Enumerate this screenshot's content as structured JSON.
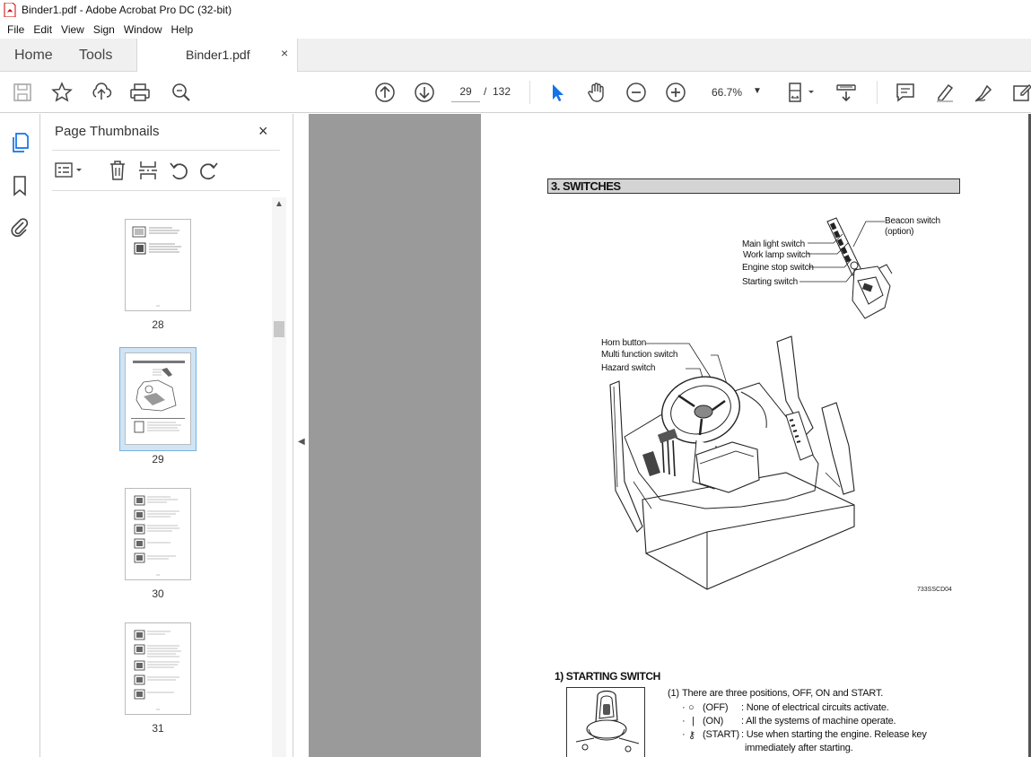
{
  "window": {
    "title": "Binder1.pdf - Adobe Acrobat Pro DC (32-bit)"
  },
  "menu": [
    "File",
    "Edit",
    "View",
    "Sign",
    "Window",
    "Help"
  ],
  "tabs": {
    "home": "Home",
    "tools": "Tools",
    "document": "Binder1.pdf",
    "close": "×"
  },
  "toolbar": {
    "page_current": "29",
    "page_sep": "/",
    "page_total": "132",
    "zoom": "66.7%",
    "zoom_caret": "▼"
  },
  "thumbnails": {
    "header": "Page Thumbnails",
    "close": "×",
    "pages": [
      {
        "label": "28"
      },
      {
        "label": "29",
        "selected": true
      },
      {
        "label": "30"
      },
      {
        "label": "31"
      }
    ]
  },
  "document": {
    "section_title": "3. SWITCHES",
    "labels": {
      "beacon": "Beacon switch",
      "beacon_option": "(option)",
      "main_light": "Main light switch",
      "work_lamp": "Work lamp switch",
      "engine_stop": "Engine stop switch",
      "starting": "Starting switch",
      "horn": "Horn button",
      "multi_function": "Multi function switch",
      "hazard": "Hazard switch"
    },
    "figure_code": "733SSCD04",
    "subsection_title": "1) STARTING SWITCH",
    "para_num": "(1)",
    "para_text": "There are three positions, OFF, ON and START.",
    "positions": [
      {
        "mark": "·",
        "symbol": "○",
        "name": "(OFF)",
        "desc": ": None of electrical circuits activate."
      },
      {
        "mark": "·",
        "symbol": "|",
        "name": "(ON)",
        "desc": ": All the systems of machine operate."
      },
      {
        "mark": "·",
        "symbol": "⚷",
        "name": "(START)",
        "desc": ": Use when starting the engine. Release key",
        "desc2": "immediately after starting."
      }
    ]
  }
}
